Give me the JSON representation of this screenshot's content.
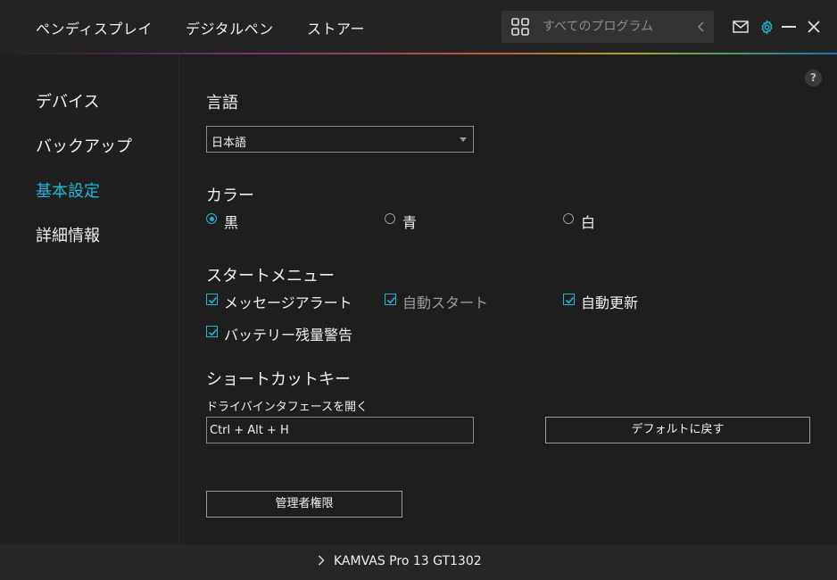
{
  "nav": {
    "tabs": [
      "ペンディスプレイ",
      "デジタルペン",
      "ストアー"
    ]
  },
  "search": {
    "placeholder": "すべてのプログラム",
    "icon": "grid-icon"
  },
  "window_controls": [
    "mail-icon",
    "settings-icon",
    "minimize-icon",
    "close-icon"
  ],
  "colors": {
    "accent": "#1fb7d4",
    "background": "#1e1e1e",
    "text": "#f0f0f0"
  },
  "sidebar": {
    "items": [
      {
        "label": "デバイス",
        "active": false
      },
      {
        "label": "バックアップ",
        "active": false
      },
      {
        "label": "基本設定",
        "active": true
      },
      {
        "label": "詳細情報",
        "active": false
      }
    ]
  },
  "main": {
    "help_label": "?",
    "language": {
      "title": "言語",
      "selected": "日本語"
    },
    "color": {
      "title": "カラー",
      "options": [
        {
          "label": "黒",
          "selected": true
        },
        {
          "label": "青",
          "selected": false
        },
        {
          "label": "白",
          "selected": false
        }
      ]
    },
    "start_menu": {
      "title": "スタートメニュー",
      "options": [
        {
          "label": "メッセージアラート",
          "checked": true,
          "enabled": true
        },
        {
          "label": "自動スタート",
          "checked": true,
          "enabled": false
        },
        {
          "label": "自動更新",
          "checked": true,
          "enabled": true
        },
        {
          "label": "バッテリー残量警告",
          "checked": true,
          "enabled": true
        }
      ]
    },
    "shortcut": {
      "title": "ショートカットキー",
      "label": "ドライバインタフェースを開く",
      "value": "Ctrl + Alt + H",
      "reset_label": "デフォルトに戻す"
    },
    "admin_label": "管理者権限"
  },
  "footer": {
    "device_name": "KAMVAS Pro 13 GT1302"
  }
}
